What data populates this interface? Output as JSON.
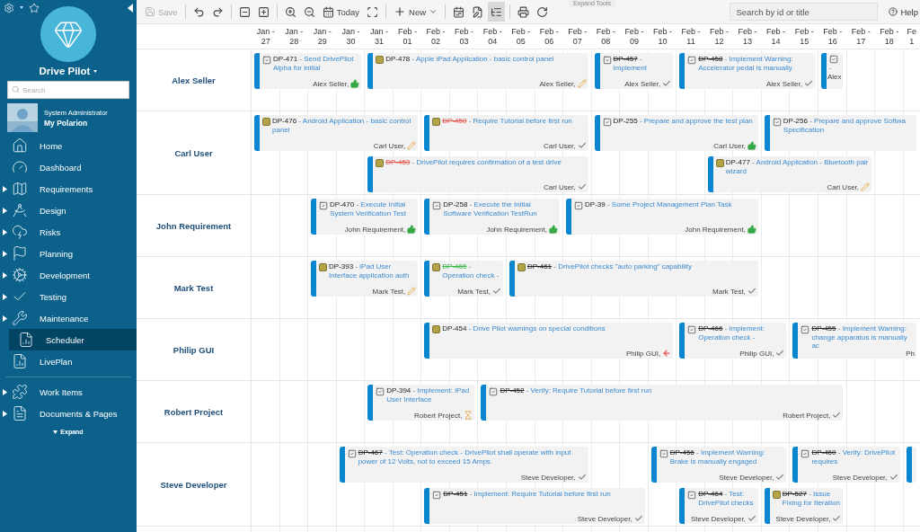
{
  "sidebar": {
    "project": "Drive Pilot",
    "search": {
      "placeholder": "Search"
    },
    "user": {
      "role": "System Administrator",
      "name": "My Polarion"
    },
    "nav": [
      {
        "label": "Home",
        "expandable": false,
        "selected": false
      },
      {
        "label": "Dashboard",
        "expandable": false,
        "selected": false
      },
      {
        "label": "Requirements",
        "expandable": true,
        "selected": false
      },
      {
        "label": "Design",
        "expandable": true,
        "selected": false
      },
      {
        "label": "Risks",
        "expandable": true,
        "selected": false
      },
      {
        "label": "Planning",
        "expandable": true,
        "selected": false
      },
      {
        "label": "Development",
        "expandable": true,
        "selected": false
      },
      {
        "label": "Testing",
        "expandable": true,
        "selected": false
      },
      {
        "label": "Maintenance",
        "expandable": true,
        "selected": false
      },
      {
        "label": "Scheduler",
        "expandable": false,
        "selected": true
      },
      {
        "label": "LivePlan",
        "expandable": false,
        "selected": false
      }
    ],
    "nav_secondary": [
      {
        "label": "Work Items",
        "expandable": true,
        "selected": false
      },
      {
        "label": "Documents & Pages",
        "expandable": true,
        "selected": false
      }
    ],
    "footer": "Expand"
  },
  "toolbar": {
    "save": {
      "label": "Save",
      "disabled": true
    },
    "today": "Today",
    "new": "New",
    "view_toggles": [
      {
        "selected": false
      },
      {
        "selected": false
      },
      {
        "selected": true
      }
    ],
    "expand_tools": "Expand Tools",
    "search": {
      "placeholder": "Search by id or title"
    },
    "help": "Help"
  },
  "days": [
    {
      "month": "Jan -",
      "day": "27"
    },
    {
      "month": "Jan -",
      "day": "28"
    },
    {
      "month": "Jan -",
      "day": "29"
    },
    {
      "month": "Jan -",
      "day": "30"
    },
    {
      "month": "Jan -",
      "day": "31"
    },
    {
      "month": "Feb -",
      "day": "01"
    },
    {
      "month": "Feb -",
      "day": "02"
    },
    {
      "month": "Feb -",
      "day": "03"
    },
    {
      "month": "Feb -",
      "day": "04"
    },
    {
      "month": "Feb -",
      "day": "05"
    },
    {
      "month": "Feb -",
      "day": "06"
    },
    {
      "month": "Feb -",
      "day": "07"
    },
    {
      "month": "Feb -",
      "day": "08"
    },
    {
      "month": "Feb -",
      "day": "09"
    },
    {
      "month": "Feb -",
      "day": "10"
    },
    {
      "month": "Feb -",
      "day": "11"
    },
    {
      "month": "Feb -",
      "day": "12"
    },
    {
      "month": "Feb -",
      "day": "13"
    },
    {
      "month": "Feb -",
      "day": "14"
    },
    {
      "month": "Feb -",
      "day": "15"
    },
    {
      "month": "Feb -",
      "day": "16"
    },
    {
      "month": "Feb -",
      "day": "17"
    },
    {
      "month": "Feb -",
      "day": "18"
    },
    {
      "month": "Fe",
      "day": "1"
    }
  ],
  "resources": [
    {
      "name": "Alex Seller",
      "lanes": [
        [
          {
            "kind": "task",
            "id": {
              "text": "DP-471",
              "struck": false
            },
            "title": "- Send DrivePilot Alpha for initial",
            "assignee": "Alex Seller,",
            "status": {
              "kind": "approved"
            }
          },
          {
            "kind": "requirement",
            "id": {
              "text": "DP-478",
              "struck": false
            },
            "title": "- Apple iPad Application - basic control panel",
            "assignee": "Alex Seller,",
            "status": {
              "kind": "draft"
            }
          },
          {
            "kind": "task",
            "id": {
              "text": "DP-457",
              "struck": true
            },
            "title": "- Implement",
            "assignee": "Alex Seller,",
            "status": {
              "kind": "done"
            }
          },
          {
            "kind": "task",
            "id": {
              "text": "DP-458",
              "struck": true
            },
            "title": "- Implement Warning: Accelerator pedal is manually",
            "assignee": "Alex Seller,",
            "status": {
              "kind": "done"
            }
          },
          {
            "kind": "narrow",
            "title": "-",
            "assignee": "Alex"
          }
        ]
      ]
    },
    {
      "name": "Carl User",
      "lanes": [
        [
          {
            "kind": "requirement",
            "id": {
              "text": "DP-476",
              "struck": false
            },
            "title": "- Android Application - basic control panel",
            "assignee": "Carl User,",
            "status": {
              "kind": "draft"
            }
          },
          {
            "kind": "requirement",
            "id": {
              "text": "DP-450",
              "struck": true,
              "color": "#e5534b"
            },
            "title": "- Require Tutorial before first run",
            "assignee": "Carl User,",
            "status": {
              "kind": "done"
            }
          },
          {
            "kind": "task",
            "id": {
              "text": "DP-255",
              "struck": false
            },
            "title": "- Prepare and approve the test plan",
            "assignee": "Carl User,",
            "status": {
              "kind": "approved"
            }
          },
          {
            "kind": "task",
            "id": {
              "text": "DP-256",
              "struck": false
            },
            "title": "- Prepare and approve Softwa Specification"
          }
        ],
        [
          {
            "kind": "requirement",
            "id": {
              "text": "DP-453",
              "struck": true,
              "color": "#e5534b"
            },
            "title": "- DrivePilot requires confirmation of a test drive",
            "assignee": "Carl User,",
            "status": {
              "kind": "done"
            }
          },
          {
            "kind": "requirement",
            "id": {
              "text": "DP-477",
              "struck": false
            },
            "title": "- Android Application - Bluetooth pair wizard",
            "assignee": "Carl User,",
            "status": {
              "kind": "draft"
            }
          }
        ]
      ]
    },
    {
      "name": "John Requirement",
      "lanes": [
        [
          {
            "kind": "task",
            "id": {
              "text": "DP-470",
              "struck": false
            },
            "title": "- Execute Initial System Verification Test",
            "assignee": "John Requirement,",
            "status": {
              "kind": "approved"
            }
          },
          {
            "kind": "task",
            "id": {
              "text": "DP-258",
              "struck": false
            },
            "title": "- Execute the Initial Software Verification TestRun",
            "assignee": "John Requirement,",
            "status": {
              "kind": "approved"
            }
          },
          {
            "kind": "task",
            "id": {
              "text": "DP-39",
              "struck": false
            },
            "title": "- Some Project Management Plan Task",
            "assignee": "John Requirement,",
            "status": {
              "kind": "approved"
            }
          }
        ]
      ]
    },
    {
      "name": "Mark Test",
      "lanes": [
        [
          {
            "kind": "requirement",
            "id": {
              "text": "DP-393",
              "struck": false
            },
            "title": "- iPad User Interface application auth",
            "assignee": "Mark Test,",
            "status": {
              "kind": "draft"
            }
          },
          {
            "kind": "requirement",
            "id": {
              "text": "DP-465",
              "struck": true,
              "color": "#3bb54a"
            },
            "title": "- Operation check -",
            "assignee": "Mark Test,",
            "status": {
              "kind": "done"
            }
          },
          {
            "kind": "requirement",
            "id": {
              "text": "DP-461",
              "struck": true
            },
            "title": "- DrivePilot checks \"auto parking\" capability",
            "assignee": "Mark Test,",
            "status": {
              "kind": "done"
            }
          }
        ]
      ]
    },
    {
      "name": "Philip GUI",
      "lanes": [
        [
          {
            "kind": "requirement",
            "id": {
              "text": "DP-454",
              "struck": false
            },
            "title": "- Drive Pilot warnings on special conditions",
            "assignee": "Philip GUI,",
            "status": {
              "kind": "returned"
            }
          },
          {
            "kind": "task",
            "id": {
              "text": "DP-466",
              "struck": true
            },
            "title": "- Implement: Operation check -",
            "assignee": "Philip GUI,",
            "status": {
              "kind": "done"
            }
          },
          {
            "kind": "task",
            "id": {
              "text": "DP-455",
              "struck": true
            },
            "title": "- Implement Warning: change apparatus is manually ac",
            "assignee": "Ph"
          }
        ]
      ]
    },
    {
      "name": "Robert Project",
      "lanes": [
        [
          {
            "kind": "task",
            "id": {
              "text": "DP-394",
              "struck": false
            },
            "title": "- Implement: iPad User Interface",
            "assignee": "Robert Project,",
            "status": {
              "kind": "waiting"
            }
          },
          {
            "kind": "task",
            "id": {
              "text": "DP-452",
              "struck": true
            },
            "title": "- Verify: Require Tutorial before first run",
            "assignee": "Robert Project,",
            "status": {
              "kind": "done"
            }
          }
        ]
      ]
    },
    {
      "name": "Steve Developer",
      "lanes": [
        [
          {
            "kind": "task",
            "id": {
              "text": "DP-467",
              "struck": true
            },
            "title": "- Test: Operation check - DrivePilot shall operate with input power of 12 Volts, not to exceed 15 Amps.",
            "assignee": "Steve Developer,",
            "status": {
              "kind": "done"
            }
          },
          {
            "kind": "task",
            "id": {
              "text": "DP-456",
              "struck": true
            },
            "title": "- Implement Warning: Brake is manually engaged",
            "assignee": "Steve Developer,",
            "status": {
              "kind": "done"
            }
          },
          {
            "kind": "task",
            "id": {
              "text": "DP-460",
              "struck": true
            },
            "title": "- Verify: DrivePilot requires",
            "assignee": "Steve Developer,",
            "status": {
              "kind": "done"
            }
          },
          {
            "kind": "stub"
          }
        ],
        [
          {
            "kind": "task",
            "id": {
              "text": "DP-451",
              "struck": true
            },
            "title": "- Implement: Require Tutorial before first run",
            "assignee": "Steve Developer,",
            "status": {
              "kind": "done"
            }
          },
          {
            "kind": "task",
            "id": {
              "text": "DP-464",
              "struck": true
            },
            "title": "- Test: DrivePilot checks",
            "assignee": "Steve Developer,",
            "status": {
              "kind": "done"
            }
          },
          {
            "kind": "requirement",
            "id": {
              "text": "DP-527",
              "struck": true
            },
            "title": "- Issue Fixing for Iteration",
            "assignee": "Steve Developer,",
            "status": {
              "kind": "done"
            }
          }
        ]
      ]
    }
  ]
}
